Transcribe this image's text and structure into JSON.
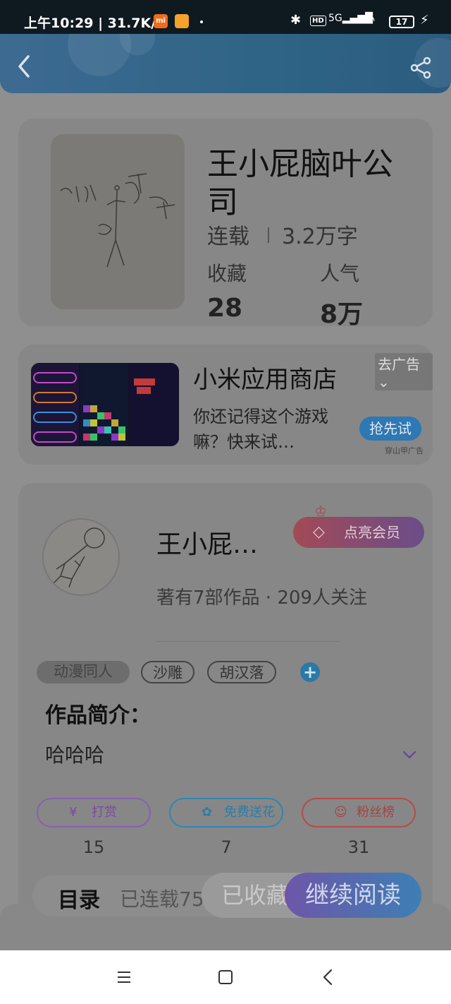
{
  "status_bar": {
    "time_speed": "上午10:29 | 31.7K/s",
    "network": "5G",
    "battery": "17"
  },
  "book": {
    "title": "王小屁脑叶公司",
    "status": "连载",
    "words": "3.2万字",
    "favorites_label": "收藏",
    "popularity_label": "人气",
    "favorites_value": "28",
    "popularity_value": "8万"
  },
  "ad": {
    "title": "小米应用商店",
    "description": "你还记得这个游戏嘛？快来试…",
    "close_label": "去广告",
    "cta_label": "抢先试",
    "source": "穿山甲广告"
  },
  "author": {
    "name": "王小屁…",
    "vip_label": "点亮会员",
    "stats": "著有7部作品 · 209人关注"
  },
  "tags": [
    "动漫同人",
    "沙雕",
    "胡汉落"
  ],
  "intro": {
    "label": "作品简介：",
    "text": "哈哈哈"
  },
  "actions": [
    {
      "label": "打赏",
      "icon": "yen-icon",
      "count": "15"
    },
    {
      "label": "免费送花",
      "icon": "flower-icon",
      "count": "7"
    },
    {
      "label": "粉丝榜",
      "icon": "fans-icon",
      "count": "31"
    }
  ],
  "bottom": {
    "toc_label": "目录",
    "toc_status": "已连载75",
    "favorited_label": "已收藏",
    "continue_label": "继续阅读"
  },
  "colors": {
    "header": "#2f6486",
    "accent_blue": "#2e78b3",
    "vip_gradient_start": "#a34a55",
    "vip_gradient_end": "#6a4d8a"
  }
}
